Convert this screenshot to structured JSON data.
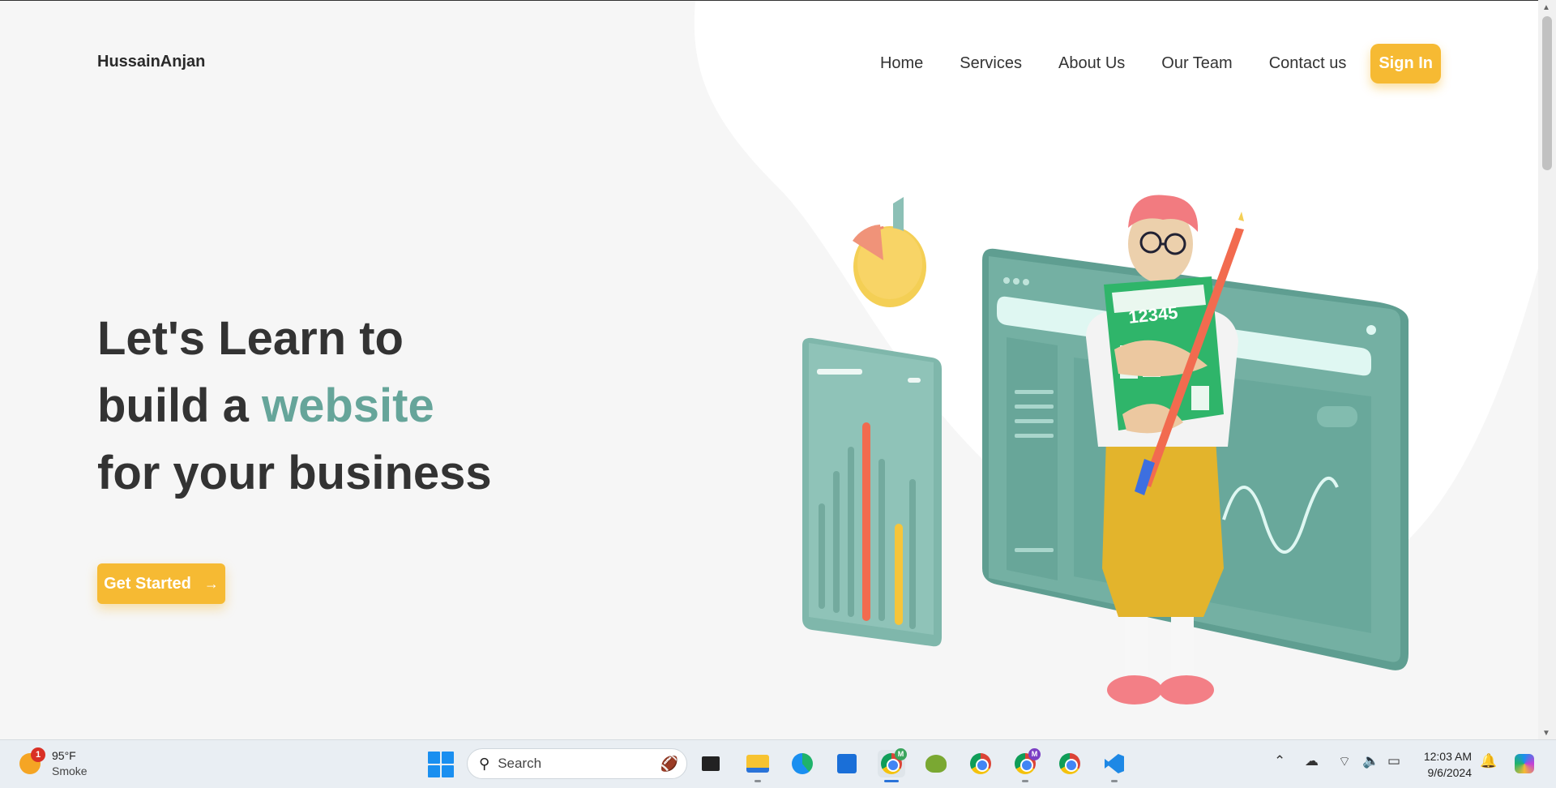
{
  "brand": "HussainAnjan",
  "nav": {
    "items": [
      "Home",
      "Services",
      "About Us",
      "Our Team",
      "Contact us"
    ],
    "signin_label": "Sign In"
  },
  "hero": {
    "line1": "Let's Learn to",
    "line2_prefix": "build a ",
    "line2_highlight": "website",
    "line3": "for your business",
    "cta_label": "Get Started",
    "cta_arrow": "→"
  },
  "illustration": {
    "calculator_display": "12345"
  },
  "colors": {
    "accent": "#f6ba33",
    "highlight": "#66a59a",
    "teal_panel": "#6fb0a3"
  },
  "taskbar": {
    "weather_temp": "95°F",
    "weather_desc": "Smoke",
    "weather_badge": "1",
    "search_placeholder": "Search",
    "apps": [
      "task-view-icon",
      "file-explorer-icon",
      "edge-icon",
      "microsoft-store-icon",
      "chrome-icon",
      "chameleon-app-icon",
      "chrome-icon",
      "chrome-icon",
      "chrome-icon",
      "vscode-icon"
    ],
    "chrome_profile_1": "M",
    "chrome_profile_2": "M",
    "time": "12:03 AM",
    "date": "9/6/2024"
  }
}
